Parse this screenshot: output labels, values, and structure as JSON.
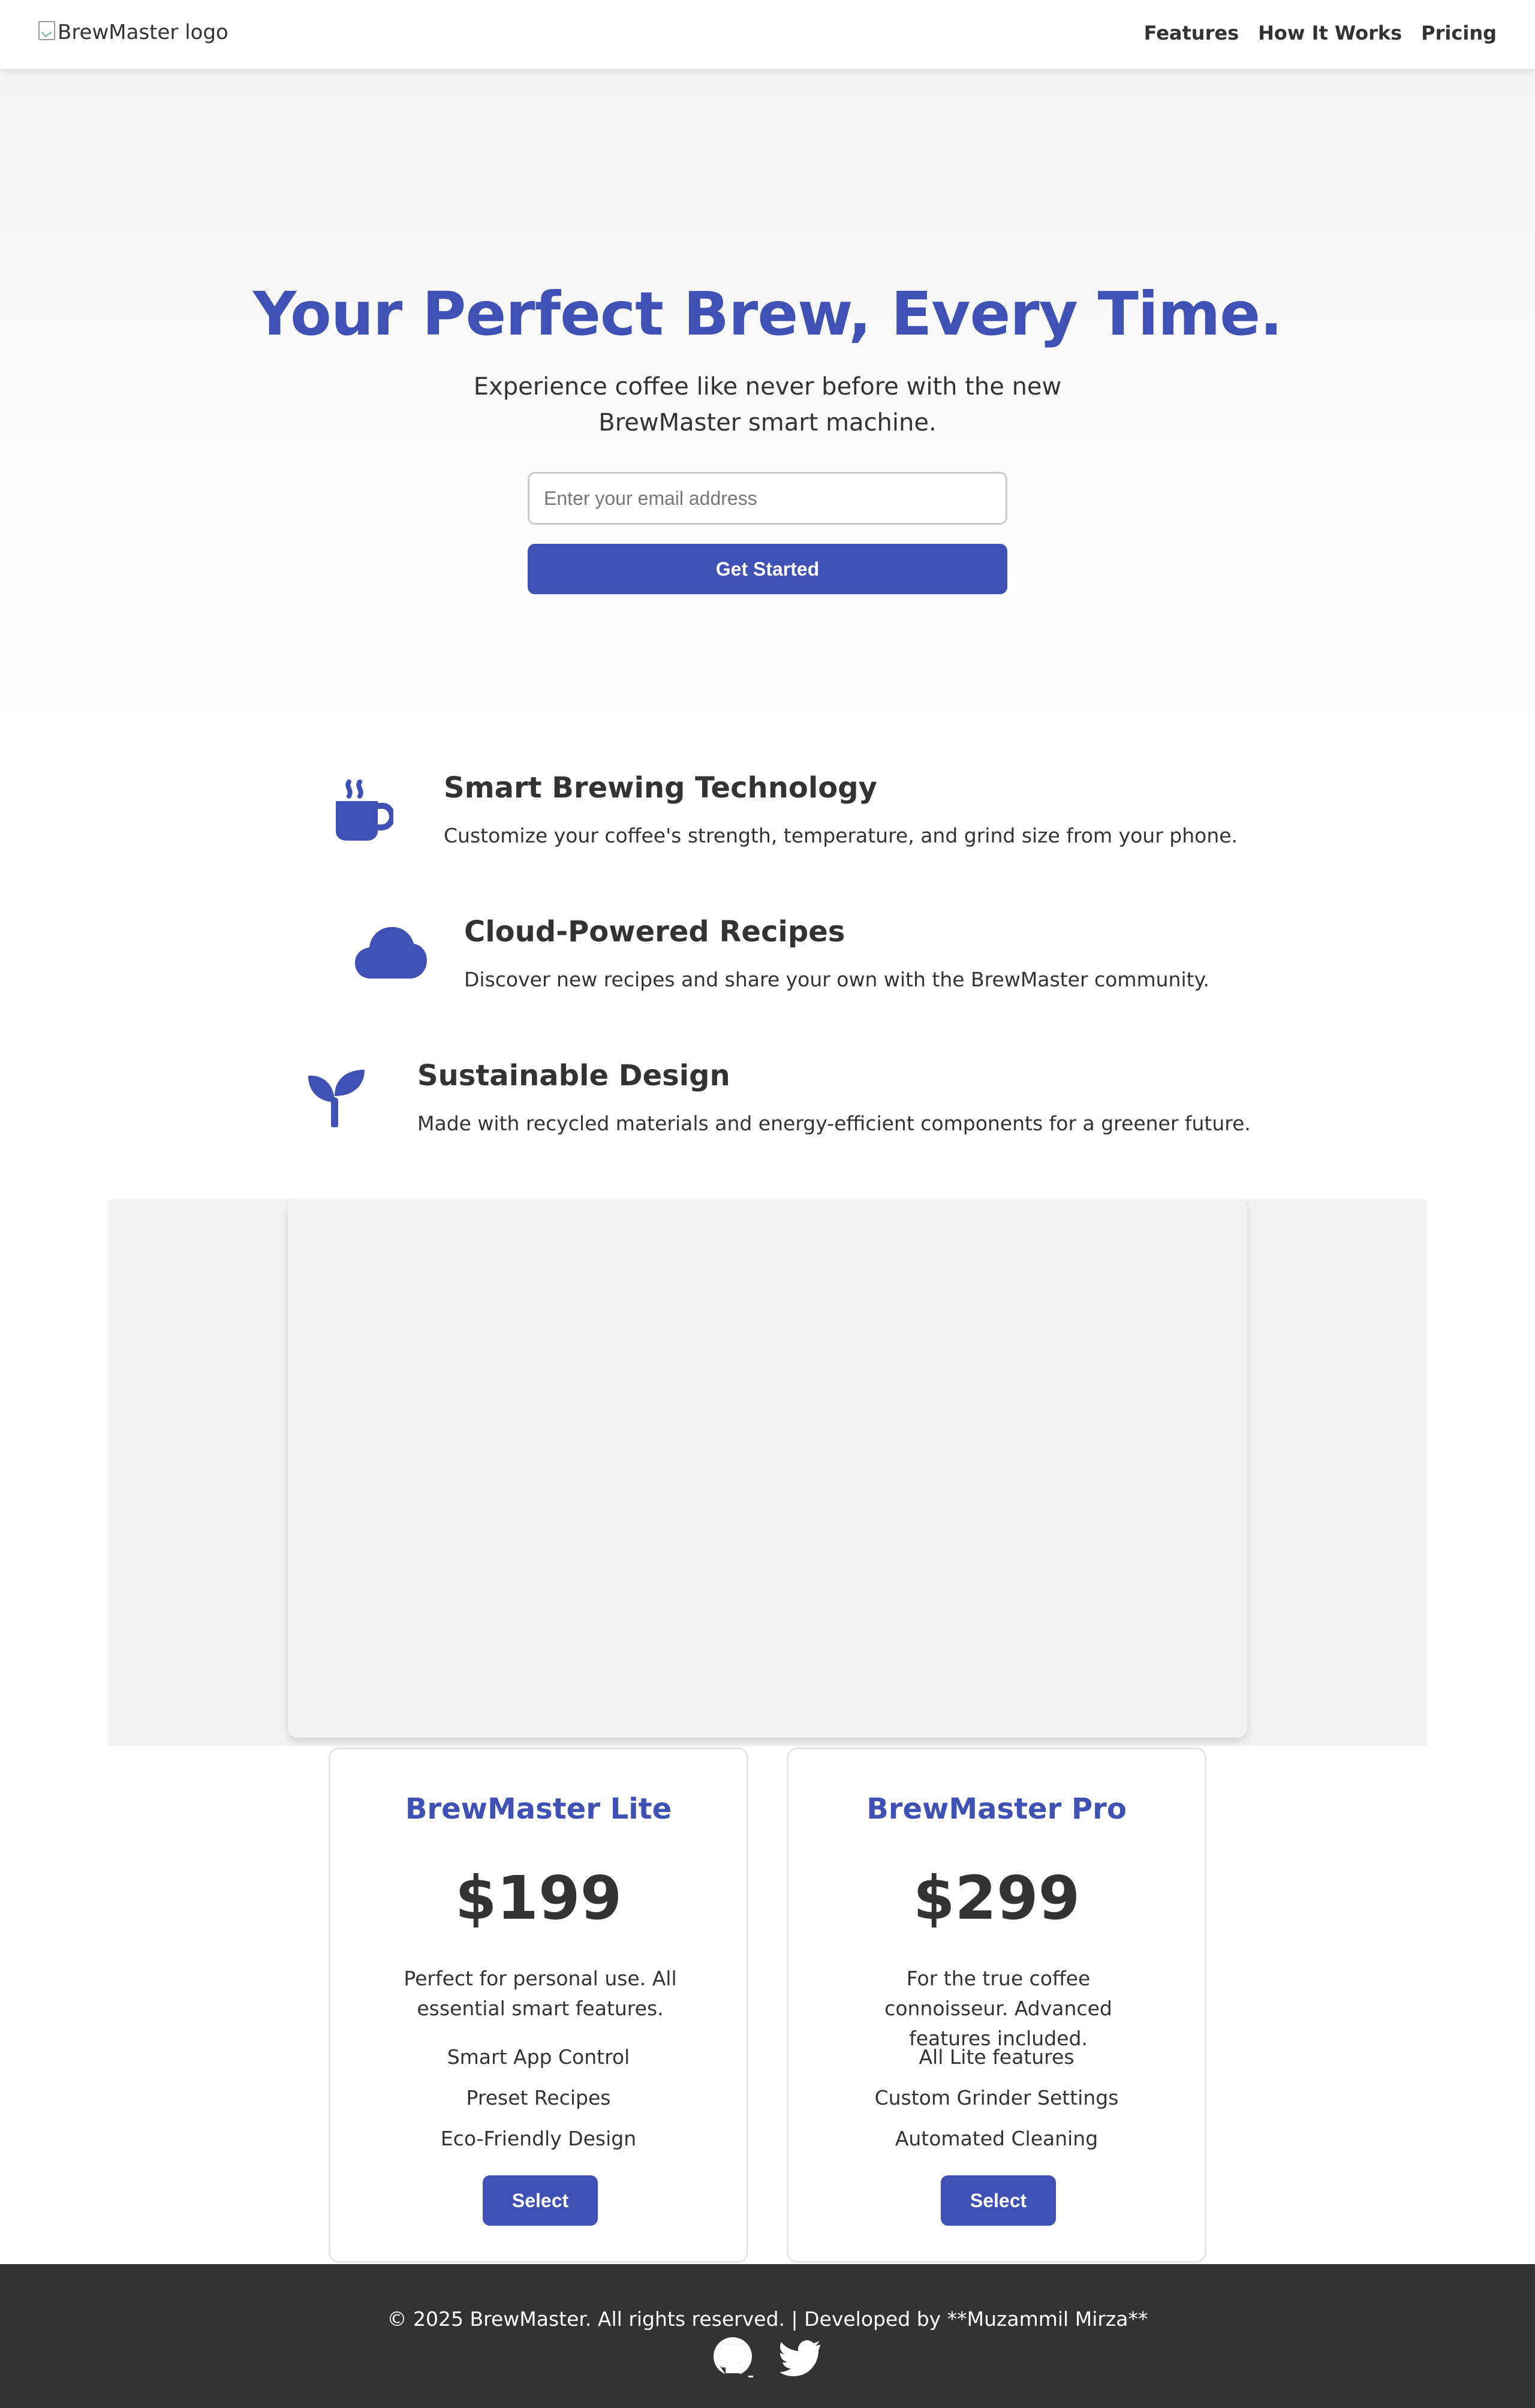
{
  "header": {
    "logo_alt": "BrewMaster logo",
    "nav": [
      {
        "label": "Features"
      },
      {
        "label": "How It Works"
      },
      {
        "label": "Pricing"
      }
    ]
  },
  "hero": {
    "title": "Your Perfect Brew, Every Time.",
    "subtitle": "Experience coffee like never before with the new BrewMaster smart machine.",
    "email_placeholder": "Enter your email address",
    "cta_label": "Get Started"
  },
  "features": [
    {
      "icon": "coffee-cup-icon",
      "title": "Smart Brewing Technology",
      "text": "Customize your coffee's strength, temperature, and grind size from your phone."
    },
    {
      "icon": "cloud-icon",
      "title": "Cloud-Powered Recipes",
      "text": "Discover new recipes and share your own with the BrewMaster community."
    },
    {
      "icon": "seedling-icon",
      "title": "Sustainable Design",
      "text": "Made with recycled materials and energy-efficient components for a greener future."
    }
  ],
  "pricing": [
    {
      "name": "BrewMaster Lite",
      "price": "$199",
      "description": "Perfect for personal use. All essential smart features.",
      "features": [
        "Smart App Control",
        "Preset Recipes",
        "Eco-Friendly Design"
      ],
      "button_label": "Select"
    },
    {
      "name": "BrewMaster Pro",
      "price": "$299",
      "description": "For the true coffee connoisseur. Advanced features included.",
      "features": [
        "All Lite features",
        "Custom Grinder Settings",
        "Automated Cleaning"
      ],
      "button_label": "Select"
    }
  ],
  "footer": {
    "text": "© 2025 BrewMaster. All rights reserved. | Developed by **Muzammil Mirza**",
    "social": [
      "github-icon",
      "twitter-icon"
    ]
  },
  "colors": {
    "accent": "#3f51b5",
    "text": "#333333",
    "footer_bg": "#333333"
  }
}
